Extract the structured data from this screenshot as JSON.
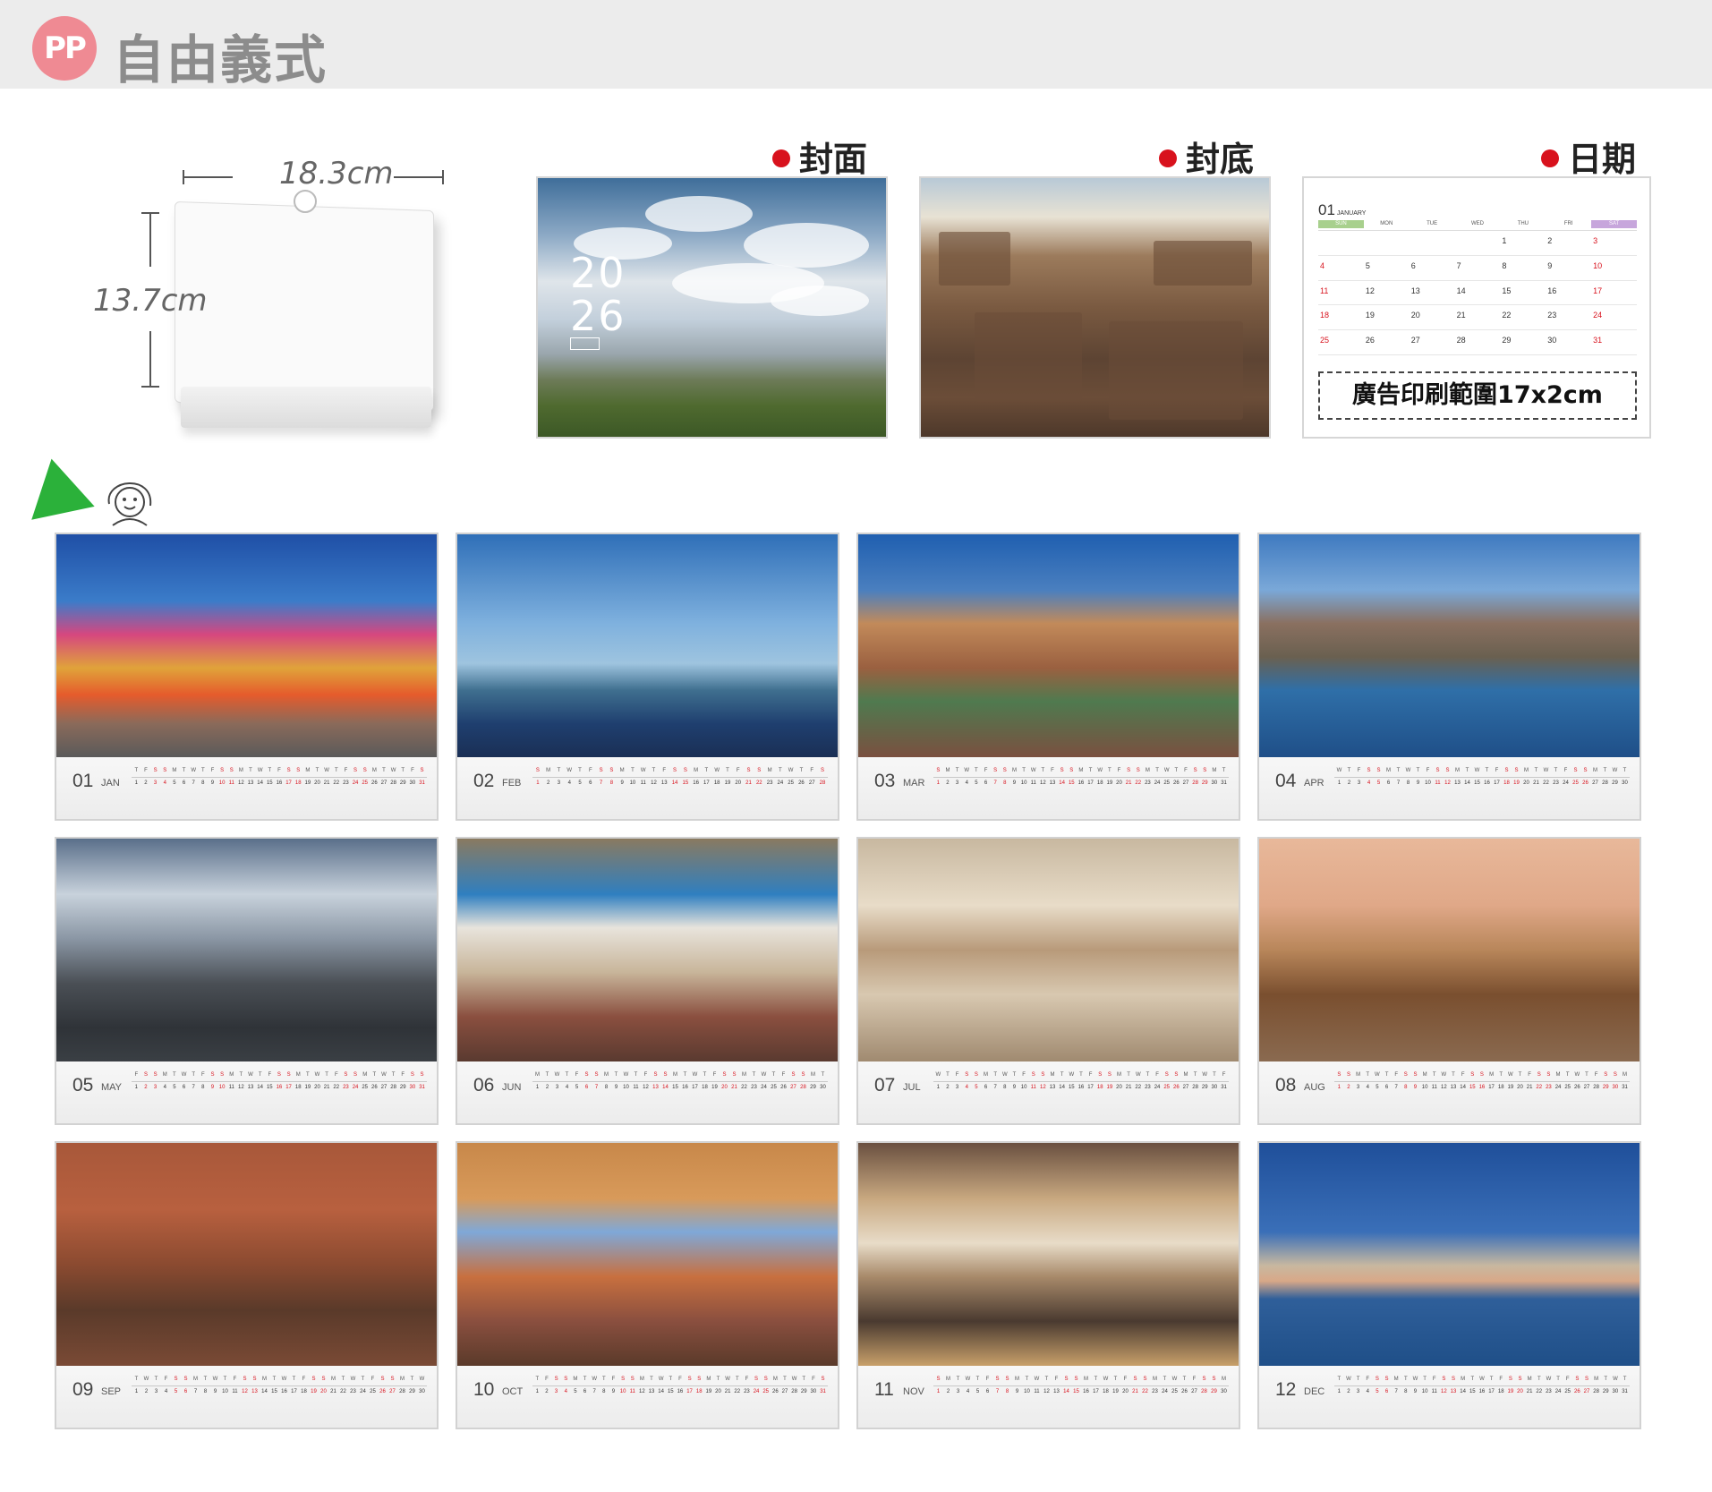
{
  "header": {
    "badge": "PP",
    "title": "自由義式"
  },
  "product": {
    "width_label": "18.3cm",
    "height_label": "13.7cm"
  },
  "sections": {
    "cover": "封面",
    "back": "封底",
    "date": "日期"
  },
  "cover": {
    "year_top": "20",
    "year_bottom": "26"
  },
  "date_page": {
    "month_num": "01",
    "month_name": "JANUARY",
    "weekdays": [
      "SUN",
      "MON",
      "TUE",
      "WED",
      "THU",
      "FRI",
      "SAT"
    ],
    "weeks": [
      [
        "",
        "",
        "",
        "",
        "1",
        "2",
        "3"
      ],
      [
        "4",
        "5",
        "6",
        "7",
        "8",
        "9",
        "10"
      ],
      [
        "11",
        "12",
        "13",
        "14",
        "15",
        "16",
        "17"
      ],
      [
        "18",
        "19",
        "20",
        "21",
        "22",
        "23",
        "24"
      ],
      [
        "25",
        "26",
        "27",
        "28",
        "29",
        "30",
        "31"
      ]
    ],
    "ad_label": "廣告印刷範圍17x2cm"
  },
  "months": [
    {
      "num": "01",
      "name": "JAN",
      "start": 4,
      "days": 31
    },
    {
      "num": "02",
      "name": "FEB",
      "start": 0,
      "days": 28
    },
    {
      "num": "03",
      "name": "MAR",
      "start": 0,
      "days": 31
    },
    {
      "num": "04",
      "name": "APR",
      "start": 3,
      "days": 30
    },
    {
      "num": "05",
      "name": "MAY",
      "start": 5,
      "days": 31
    },
    {
      "num": "06",
      "name": "JUN",
      "start": 1,
      "days": 30
    },
    {
      "num": "07",
      "name": "JUL",
      "start": 3,
      "days": 31
    },
    {
      "num": "08",
      "name": "AUG",
      "start": 6,
      "days": 31
    },
    {
      "num": "09",
      "name": "SEP",
      "start": 2,
      "days": 30
    },
    {
      "num": "10",
      "name": "OCT",
      "start": 4,
      "days": 31
    },
    {
      "num": "11",
      "name": "NOV",
      "start": 0,
      "days": 30
    },
    {
      "num": "12",
      "name": "DEC",
      "start": 2,
      "days": 31
    }
  ],
  "colors": {
    "accent_red": "#d8121d",
    "badge_pink": "#ef8a93",
    "header_bg": "#ececec"
  }
}
